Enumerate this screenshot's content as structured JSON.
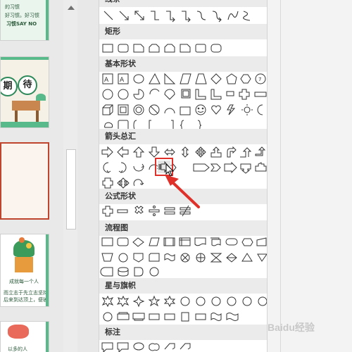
{
  "slides": [
    {
      "text_1": "的习惯",
      "text_2": "好习惯。好习惯",
      "text_3": "习惯SAY NO"
    },
    {
      "text_1": "期",
      "text_2": "待"
    },
    {},
    {
      "text_1": "成就每一个人",
      "text_2": "而立志于先立志坚持之",
      "text_3": "后来到达顶上，便被视就就"
    },
    {
      "text_1": "以多的人"
    }
  ],
  "menu": {
    "categories": {
      "lines": "线条",
      "rectangles": "矩形",
      "basic": "基本形状",
      "arrows": "箭头总汇",
      "equation": "公式形状",
      "flowchart": "流程图",
      "stars": "星与旗帜",
      "callouts": "标注"
    },
    "basic_labels": {
      "ten": "10",
      "twelve": "12",
      "octagon": "8"
    },
    "highlight_shape": "notched-right-arrow"
  },
  "colors": {
    "highlight": "#e0302a",
    "arrow": "#e0302a",
    "selected_border": "#c0452f"
  },
  "watermark": "Baidu经验"
}
